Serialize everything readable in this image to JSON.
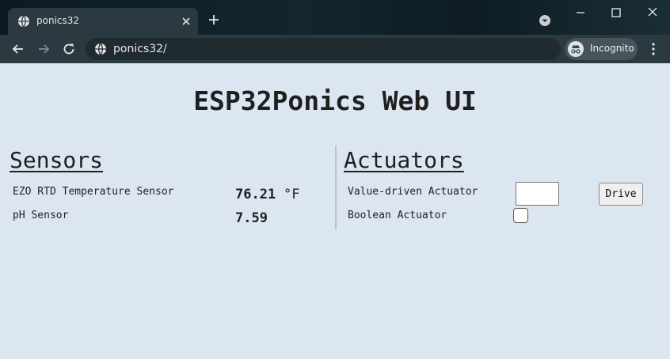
{
  "browser": {
    "tab_title": "ponics32",
    "url": "ponics32/",
    "incognito_label": "Incognito"
  },
  "page": {
    "title": "ESP32Ponics Web UI",
    "sensors": {
      "heading": "Sensors",
      "items": [
        {
          "label": "EZO RTD Temperature Sensor",
          "value": "76.21",
          "unit": "°F"
        },
        {
          "label": "pH Sensor",
          "value": "7.59",
          "unit": ""
        }
      ]
    },
    "actuators": {
      "heading": "Actuators",
      "value_driven": {
        "label": "Value-driven Actuator",
        "input_value": "",
        "button_label": "Drive"
      },
      "boolean": {
        "label": "Boolean Actuator",
        "checked": false
      }
    }
  }
}
